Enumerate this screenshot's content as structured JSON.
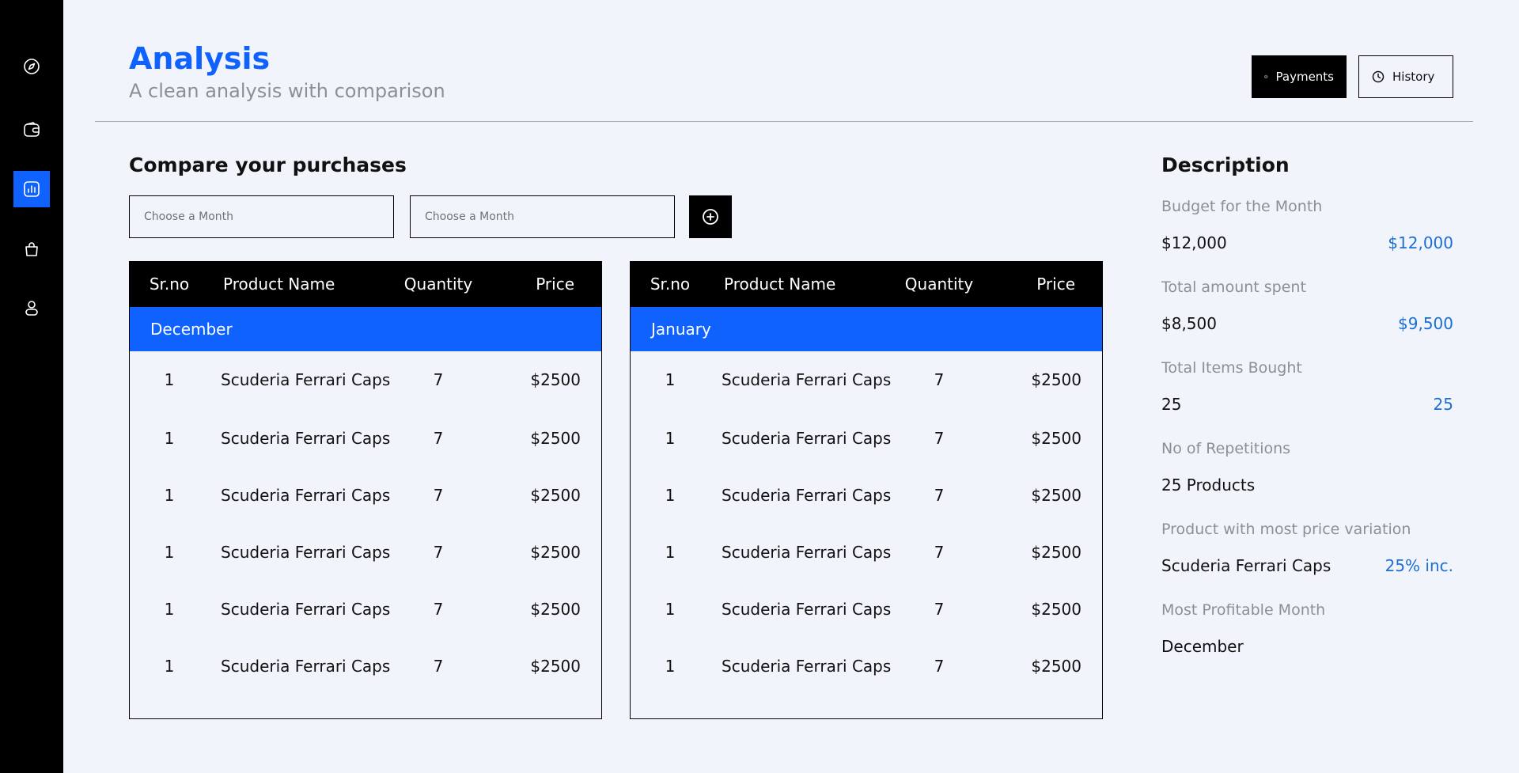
{
  "sidebar": {
    "items": [
      {
        "icon": "compass-icon",
        "active": false
      },
      {
        "icon": "wallet-icon",
        "active": false
      },
      {
        "icon": "analytics-icon",
        "active": true
      },
      {
        "icon": "shopping-bag-icon",
        "active": false
      },
      {
        "icon": "user-icon",
        "active": false
      }
    ]
  },
  "header": {
    "title": "Analysis",
    "subtitle": "A clean analysis with comparison",
    "payments_label": "Payments",
    "history_label": "History"
  },
  "compare": {
    "title": "Compare your purchases",
    "month_placeholder_1": "Choose a Month",
    "month_placeholder_2": "Choose a Month"
  },
  "table_headers": {
    "sr": "Sr.no",
    "name": "Product Name",
    "qty": "Quantity",
    "price": "Price"
  },
  "tables": [
    {
      "month": "December",
      "rows": [
        {
          "sr": "1",
          "name": "Scuderia Ferrari Caps",
          "qty": "7",
          "price": "$2500"
        },
        {
          "sr": "1",
          "name": "Scuderia Ferrari Caps",
          "qty": "7",
          "price": "$2500"
        },
        {
          "sr": "1",
          "name": "Scuderia Ferrari Caps",
          "qty": "7",
          "price": "$2500"
        },
        {
          "sr": "1",
          "name": "Scuderia Ferrari Caps",
          "qty": "7",
          "price": "$2500"
        },
        {
          "sr": "1",
          "name": "Scuderia Ferrari Caps",
          "qty": "7",
          "price": "$2500"
        },
        {
          "sr": "1",
          "name": "Scuderia Ferrari Caps",
          "qty": "7",
          "price": "$2500"
        }
      ]
    },
    {
      "month": "January",
      "rows": [
        {
          "sr": "1",
          "name": "Scuderia Ferrari Caps",
          "qty": "7",
          "price": "$2500"
        },
        {
          "sr": "1",
          "name": "Scuderia Ferrari Caps",
          "qty": "7",
          "price": "$2500"
        },
        {
          "sr": "1",
          "name": "Scuderia Ferrari Caps",
          "qty": "7",
          "price": "$2500"
        },
        {
          "sr": "1",
          "name": "Scuderia Ferrari Caps",
          "qty": "7",
          "price": "$2500"
        },
        {
          "sr": "1",
          "name": "Scuderia Ferrari Caps",
          "qty": "7",
          "price": "$2500"
        },
        {
          "sr": "1",
          "name": "Scuderia Ferrari Caps",
          "qty": "7",
          "price": "$2500"
        }
      ]
    }
  ],
  "description": {
    "title": "Description",
    "items": [
      {
        "label": "Budget for the Month",
        "value": "$12,000",
        "compare": "$12,000"
      },
      {
        "label": "Total amount spent",
        "value": "$8,500",
        "compare": "$9,500"
      },
      {
        "label": "Total Items Bought",
        "value": "25",
        "compare": "25"
      },
      {
        "label": "No of Repetitions",
        "value": "25 Products",
        "compare": ""
      },
      {
        "label": "Product with most price variation",
        "value": "Scuderia Ferrari Caps",
        "compare": "25% inc."
      },
      {
        "label": "Most Profitable Month",
        "value": "December",
        "compare": ""
      }
    ]
  },
  "colors": {
    "accent": "#0f62fe",
    "compare_text": "#1a6fd6",
    "background": "#f2f4fc",
    "sidebar": "#000000"
  }
}
